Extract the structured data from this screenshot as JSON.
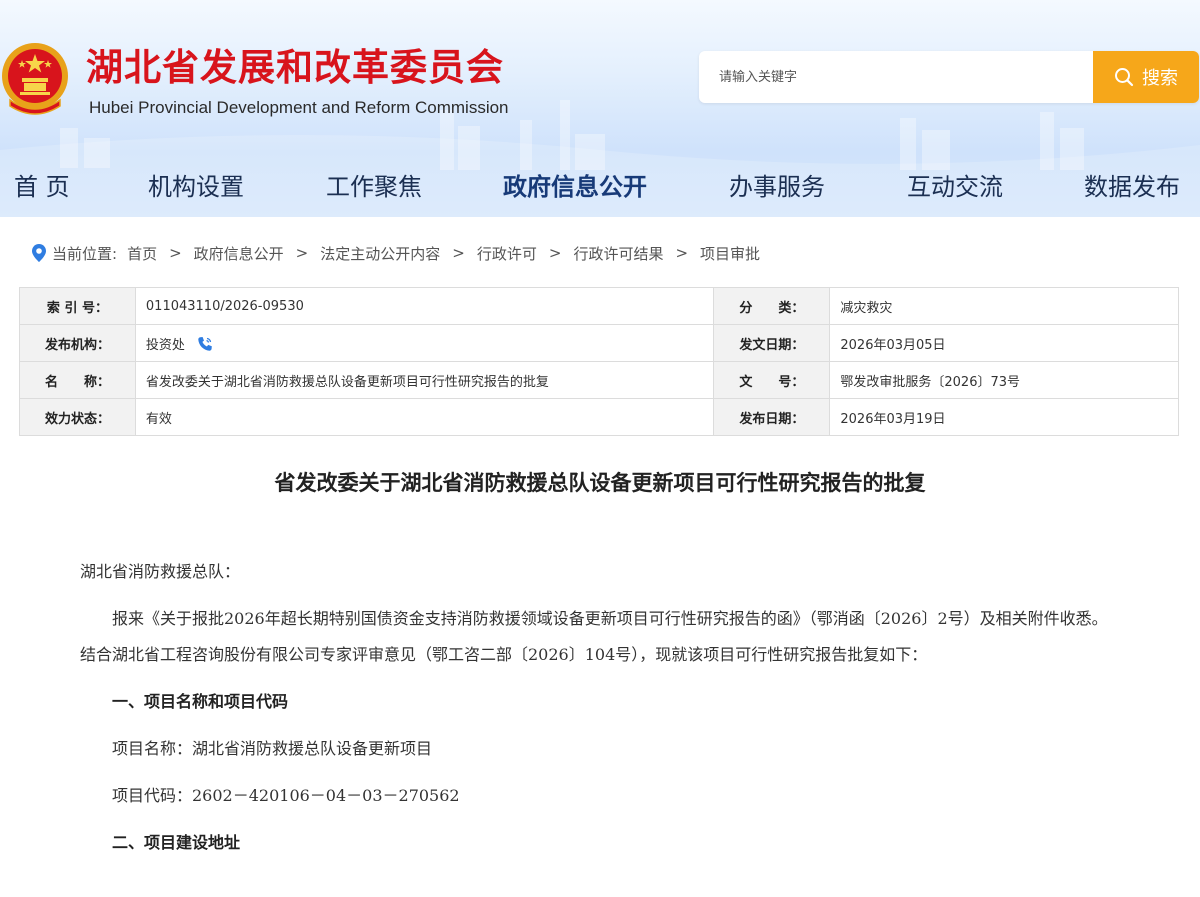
{
  "header": {
    "title": "湖北省发展和改革委员会",
    "subtitle": "Hubei Provincial Development and Reform Commission",
    "search": {
      "placeholder": "请输入关键字",
      "button_label": "搜索"
    }
  },
  "nav": {
    "items": [
      {
        "label": "首 页"
      },
      {
        "label": "机构设置"
      },
      {
        "label": "工作聚焦"
      },
      {
        "label": "政府信息公开"
      },
      {
        "label": "办事服务"
      },
      {
        "label": "互动交流"
      },
      {
        "label": "数据发布"
      }
    ],
    "active": "政府信息公开"
  },
  "breadcrumb": {
    "label": "当前位置:",
    "items": [
      "首页",
      "政府信息公开",
      "法定主动公开内容",
      "行政许可",
      "行政许可结果",
      "项目审批"
    ]
  },
  "meta": {
    "index_label": "索 引 号：",
    "index_value": "011043110/2026-09530",
    "category_label": "分　　类：",
    "category_value": "减灾救灾",
    "publisher_label": "发布机构：",
    "publisher_value": "投资处",
    "doc_date_label": "发文日期：",
    "doc_date_value": "2026年03月05日",
    "name_label": "名　　称：",
    "name_value": "省发改委关于湖北省消防救援总队设备更新项目可行性研究报告的批复",
    "doc_no_label": "文　　号：",
    "doc_no_value": "鄂发改审批服务〔2026〕73号",
    "status_label": "效力状态：",
    "status_value": "有效",
    "pub_date_label": "发布日期：",
    "pub_date_value": "2026年03月19日"
  },
  "article": {
    "title": "省发改委关于湖北省消防救援总队设备更新项目可行性研究报告的批复",
    "addressee": "湖北省消防救援总队：",
    "para1": "报来《关于报批2026年超长期特别国债资金支持消防救援领域设备更新项目可行性研究报告的函》（鄂消函〔2026〕2号）及相关附件收悉。结合湖北省工程咨询股份有限公司专家评审意见（鄂工咨二部〔2026〕104号），现就该项目可行性研究报告批复如下：",
    "section1": "一、项目名称和项目代码",
    "project_name": "项目名称：湖北省消防救援总队设备更新项目",
    "project_code": "项目代码：2602－420106－04－03－270562",
    "section2": "二、项目建设地址"
  },
  "colors": {
    "title_red": "#d8141c",
    "search_orange": "#f6a71a",
    "nav_text": "#1b2f52",
    "phone_blue": "#2f7de1",
    "pin_blue": "#2f7de1"
  },
  "icons": {
    "emblem": "national-emblem",
    "search": "search-icon",
    "location": "location-pin-icon",
    "phone": "phone-icon"
  }
}
